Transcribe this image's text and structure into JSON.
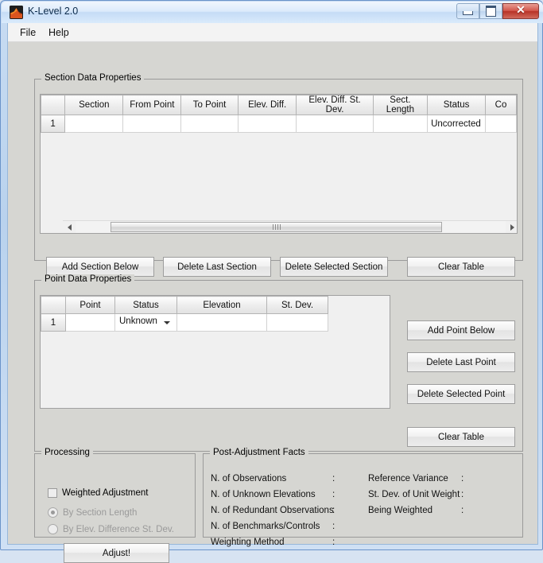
{
  "window": {
    "title": "K-Level 2.0",
    "icon": "matlab-icon",
    "controls": {
      "minimize": "minimize-icon",
      "maximize": "maximize-icon",
      "close": "close-icon"
    }
  },
  "menubar": {
    "items": [
      {
        "label": "File"
      },
      {
        "label": "Help"
      }
    ]
  },
  "section_panel": {
    "title": "Section Data Properties",
    "table": {
      "columns": [
        "",
        "Section",
        "From Point",
        "To Point",
        "Elev. Diff.",
        "Elev. Diff. St. Dev.",
        "Sect. Length",
        "Status",
        "Co"
      ],
      "rows": [
        {
          "index": "1",
          "section": "",
          "from_point": "",
          "to_point": "",
          "elev_diff": "",
          "elev_diff_st_dev": "",
          "sect_length": "",
          "status": "Uncorrected",
          "co": ""
        }
      ]
    },
    "scrollbar": {
      "left_arrow": "scroll-left-icon",
      "right_arrow": "scroll-right-icon",
      "grip": "scroll-grip-icon"
    },
    "buttons": {
      "add_section_below": "Add Section Below",
      "delete_last_section": "Delete Last Section",
      "delete_selected_section": "Delete Selected Section",
      "clear_table": "Clear Table"
    }
  },
  "point_panel": {
    "title": "Point Data Properties",
    "table": {
      "columns": [
        "",
        "Point",
        "Status",
        "Elevation",
        "St. Dev."
      ],
      "rows": [
        {
          "index": "1",
          "point": "",
          "status": "Unknown",
          "elevation": "",
          "st_dev": ""
        }
      ]
    },
    "buttons": {
      "add_point_below": "Add Point Below",
      "delete_last_point": "Delete Last Point",
      "delete_selected_point": "Delete Selected Point",
      "clear_table": "Clear Table"
    }
  },
  "processing_panel": {
    "title": "Processing",
    "weighted_adjustment": {
      "label": "Weighted Adjustment",
      "checked": false
    },
    "options": [
      {
        "label": "By Section Length",
        "selected": true,
        "enabled": false
      },
      {
        "label": "By Elev. Difference St. Dev.",
        "selected": false,
        "enabled": false
      }
    ],
    "adjust_button": "Adjust!"
  },
  "facts_panel": {
    "title": "Post-Adjustment Facts",
    "separator": ":",
    "left_column": [
      {
        "label": "N. of Observations",
        "value": ""
      },
      {
        "label": "N. of Unknown Elevations",
        "value": ""
      },
      {
        "label": "N. of Redundant Observations",
        "value": ""
      },
      {
        "label": "N. of Benchmarks/Controls",
        "value": ""
      },
      {
        "label": "Weighting Method",
        "value": ""
      }
    ],
    "right_column": [
      {
        "label": "Reference Variance",
        "value": ""
      },
      {
        "label": "St. Dev. of Unit Weight",
        "value": ""
      },
      {
        "label": "Being Weighted",
        "value": ""
      }
    ]
  },
  "colors": {
    "window_border": "#6a93c9",
    "panel_bg": "#d6d6d2",
    "close_button": "#b83226"
  }
}
